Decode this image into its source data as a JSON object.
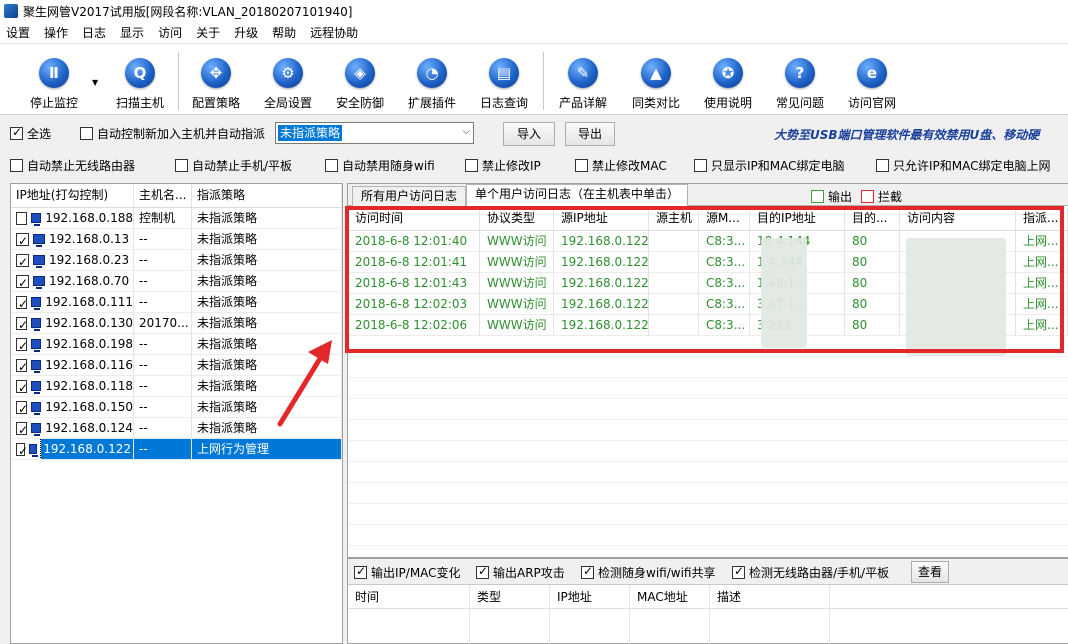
{
  "window": {
    "title": "聚生网管V2017试用版[网段名称:VLAN_20180207101940]"
  },
  "menu": [
    "设置",
    "操作",
    "日志",
    "显示",
    "访问",
    "关于",
    "升级",
    "帮助",
    "远程协助"
  ],
  "toolbar": {
    "buttons": [
      {
        "label": "停止监控",
        "icon": "pause-icon",
        "glyph": "Ⅱ"
      },
      {
        "label": "扫描主机",
        "icon": "magnifier-icon",
        "glyph": "Q"
      },
      {
        "label": "配置策略",
        "icon": "move-arrows-icon",
        "glyph": "✥"
      },
      {
        "label": "全局设置",
        "icon": "gear-icon",
        "glyph": "⚙"
      },
      {
        "label": "安全防御",
        "icon": "shield-icon",
        "glyph": "◈"
      },
      {
        "label": "扩展插件",
        "icon": "pie-chart-icon",
        "glyph": "◔"
      },
      {
        "label": "日志查询",
        "icon": "log-book-icon",
        "glyph": "▤"
      },
      {
        "label": "产品详解",
        "icon": "edit-icon",
        "glyph": "✎"
      },
      {
        "label": "同类对比",
        "icon": "graduation-cap-icon",
        "glyph": "▲"
      },
      {
        "label": "使用说明",
        "icon": "medal-icon",
        "glyph": "✪"
      },
      {
        "label": "常见问题",
        "icon": "question-icon",
        "glyph": "?"
      },
      {
        "label": "访问官网",
        "icon": "ie-browser-icon",
        "glyph": "e"
      }
    ]
  },
  "options_row1": {
    "select_all": {
      "label": "全选",
      "checked": true
    },
    "auto_control": {
      "label": "自动控制新加入主机并自动指派",
      "checked": false
    },
    "policy_combo": "未指派策略",
    "import_label": "导入",
    "export_label": "导出",
    "slogan": "大势至USB端口管理软件最有效禁用U盘、移动硬"
  },
  "options_row2": [
    {
      "label": "自动禁止无线路由器",
      "checked": false
    },
    {
      "label": "自动禁止手机/平板",
      "checked": false
    },
    {
      "label": "自动禁用随身wifi",
      "checked": false
    },
    {
      "label": "禁止修改IP",
      "checked": false
    },
    {
      "label": "禁止修改MAC",
      "checked": false
    },
    {
      "label": "只显示IP和MAC绑定电脑",
      "checked": false
    },
    {
      "label": "只允许IP和MAC绑定电脑上网",
      "checked": false
    }
  ],
  "hosts": {
    "columns": [
      "IP地址(打勾控制)",
      "主机名...",
      "指派策略"
    ],
    "rows": [
      {
        "ip": "192.168.0.188",
        "host": "控制机",
        "policy": "未指派策略",
        "checked": false
      },
      {
        "ip": "192.168.0.13",
        "host": "--",
        "policy": "未指派策略",
        "checked": true
      },
      {
        "ip": "192.168.0.23",
        "host": "--",
        "policy": "未指派策略",
        "checked": true
      },
      {
        "ip": "192.168.0.70",
        "host": "--",
        "policy": "未指派策略",
        "checked": true
      },
      {
        "ip": "192.168.0.111",
        "host": "--",
        "policy": "未指派策略",
        "checked": true
      },
      {
        "ip": "192.168.0.130",
        "host": "20170...",
        "policy": "未指派策略",
        "checked": true
      },
      {
        "ip": "192.168.0.198",
        "host": "--",
        "policy": "未指派策略",
        "checked": true
      },
      {
        "ip": "192.168.0.116",
        "host": "--",
        "policy": "未指派策略",
        "checked": true
      },
      {
        "ip": "192.168.0.118",
        "host": "--",
        "policy": "未指派策略",
        "checked": true
      },
      {
        "ip": "192.168.0.150",
        "host": "--",
        "policy": "未指派策略",
        "checked": true
      },
      {
        "ip": "192.168.0.124",
        "host": "--",
        "policy": "未指派策略",
        "checked": true
      },
      {
        "ip": "192.168.0.122",
        "host": "--",
        "policy": "上网行为管理",
        "checked": true,
        "selected": true
      }
    ]
  },
  "log_tabs": {
    "tab_all": "所有用户访问日志",
    "tab_single": "单个用户访问日志（在主机表中单击）",
    "legend_output": "输出",
    "legend_block": "拦截",
    "output_color": "#3aa33a",
    "block_color": "#e2282b"
  },
  "access_log": {
    "columns": [
      "访问时间",
      "协议类型",
      "源IP地址",
      "源主机",
      "源M...",
      "目的IP地址",
      "目的...",
      "访问内容",
      "指派..."
    ],
    "rows": [
      {
        "time": "2018-6-8 12:01:40",
        "proto": "WWW访问",
        "src_ip": "192.168.0.122",
        "src_host": "",
        "src_mac": "C8:3...",
        "dst_ip": "18.4.144",
        "dst_port": "80",
        "content": "",
        "policy": "上网..."
      },
      {
        "time": "2018-6-8 12:01:41",
        "proto": "WWW访问",
        "src_ip": "192.168.0.122",
        "src_host": "",
        "src_mac": "C8:3...",
        "dst_ip": "1.4.144",
        "dst_port": "80",
        "content": "",
        "policy": "上网..."
      },
      {
        "time": "2018-6-8 12:01:43",
        "proto": "WWW访问",
        "src_ip": "192.168.0.122",
        "src_host": "",
        "src_mac": "C8:3...",
        "dst_ip": "1.49.1...",
        "dst_port": "80",
        "content": "",
        "policy": "上网..."
      },
      {
        "time": "2018-6-8 12:02:03",
        "proto": "WWW访问",
        "src_ip": "192.168.0.122",
        "src_host": "",
        "src_mac": "C8:3...",
        "dst_ip": "3.47.1...",
        "dst_port": "80",
        "content": "",
        "policy": "上网..."
      },
      {
        "time": "2018-6-8 12:02:06",
        "proto": "WWW访问",
        "src_ip": "192.168.0.122",
        "src_host": "",
        "src_mac": "C8:3...",
        "dst_ip": "3.211",
        "dst_port": "80",
        "content": "",
        "policy": "上网..."
      }
    ]
  },
  "bottom": {
    "options": [
      {
        "label": "输出IP/MAC变化",
        "checked": true
      },
      {
        "label": "输出ARP攻击",
        "checked": true
      },
      {
        "label": "检测随身wifi/wifi共享",
        "checked": true
      },
      {
        "label": "检测无线路由器/手机/平板",
        "checked": true
      }
    ],
    "view_label": "查看",
    "columns": [
      "时间",
      "类型",
      "IP地址",
      "MAC地址",
      "描述"
    ]
  },
  "colors": {
    "selection": "#0078d7",
    "log_text": "#2f8f2f",
    "highlight": "#e2282b"
  }
}
